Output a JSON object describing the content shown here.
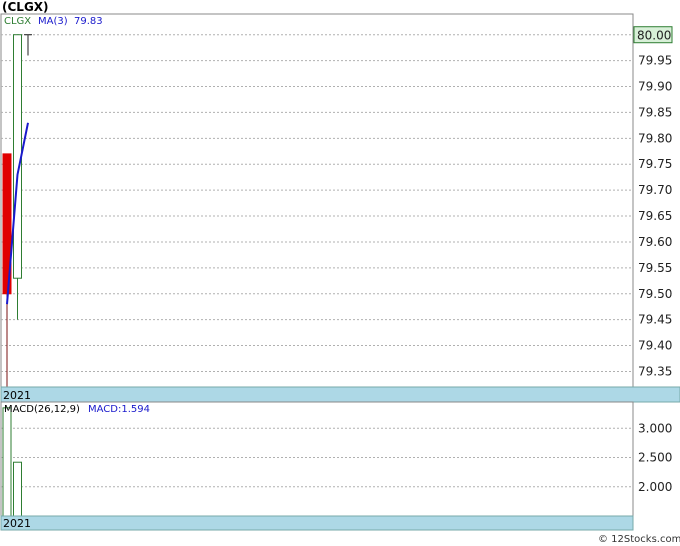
{
  "header": {
    "title": "(CLGX)"
  },
  "footer": {
    "credit": "© 12Stocks.com"
  },
  "chart_data": [
    {
      "type": "candlestick",
      "panel": "price",
      "legend": {
        "symbol": "CLGX",
        "ma_label": "MA(3)",
        "ma_value": "79.83"
      },
      "year_label": "2021",
      "ylim": [
        79.32,
        80.04
      ],
      "yticks": [
        "80.00",
        "79.95",
        "79.90",
        "79.85",
        "79.80",
        "79.75",
        "79.70",
        "79.65",
        "79.60",
        "79.55",
        "79.50",
        "79.45",
        "79.40",
        "79.35"
      ],
      "last_price_label": "80.00",
      "candles": [
        {
          "index": 0,
          "open": 79.77,
          "close": 79.5,
          "high": 79.77,
          "low": 79.3,
          "direction": "down"
        },
        {
          "index": 1,
          "open": 79.53,
          "close": 80.0,
          "high": 80.0,
          "low": 79.45,
          "direction": "up"
        },
        {
          "index": 2,
          "open": 80.0,
          "close": 80.0,
          "high": 80.0,
          "low": 79.96,
          "direction": "doji"
        }
      ],
      "ma_line": {
        "name": "MA(3)",
        "values": [
          79.48,
          79.73,
          79.83
        ]
      },
      "colors": {
        "up": "#2e7d32",
        "down": "#e00000",
        "ma": "#1a1acc",
        "band": "#add8e6",
        "tag": "#d8f0d8"
      }
    },
    {
      "type": "bar",
      "panel": "macd",
      "legend": {
        "label": "MACD(26,12,9)",
        "value_label": "MACD:1.594"
      },
      "year_label": "2021",
      "ylim": [
        1.5,
        3.45
      ],
      "yticks": [
        "3.000",
        "2.500",
        "2.000"
      ],
      "bars": [
        {
          "index": 0,
          "value": 3.35
        },
        {
          "index": 1,
          "value": 2.42
        }
      ]
    }
  ]
}
